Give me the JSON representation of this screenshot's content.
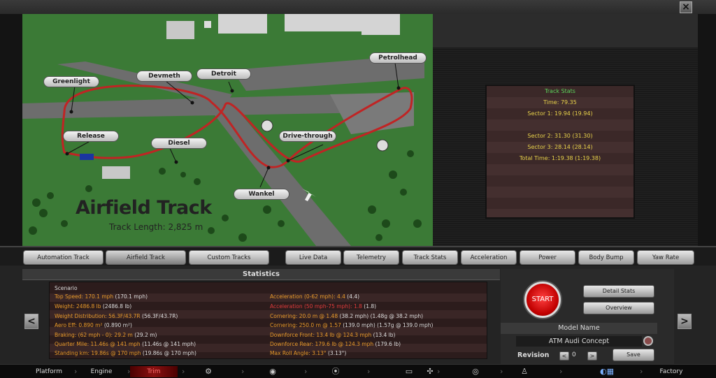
{
  "window": {
    "close_label": "×"
  },
  "map": {
    "title": "Airfield Track",
    "length": "Track Length: 2,825 m",
    "markers": [
      "Greenlight",
      "Devmeth",
      "Detroit",
      "Petrolhead",
      "Release",
      "Diesel",
      "Drive-through",
      "Wankel"
    ]
  },
  "track_stats": {
    "title": "Track Stats",
    "time": "Time: 79.35",
    "sector1": "Sector 1: 19.94 (19.94)",
    "sector2": "Sector 2: 31.30 (31.30)",
    "sector3": "Sector 3: 28.14 (28.14)",
    "total": "Total Time: 1:19.38 (1:19.38)"
  },
  "track_tabs": [
    "Automation Track",
    "Airfield Track",
    "Custom Tracks"
  ],
  "data_tabs": [
    "Live Data",
    "Telemetry",
    "Track Stats",
    "Acceleration",
    "Power",
    "Body Bump",
    "Yaw Rate"
  ],
  "statistics": {
    "title": "Statistics",
    "scenario": "Scenario",
    "left": [
      {
        "label": "Top Speed: 170.1 mph",
        "extra": " (170.1 mph)"
      },
      {
        "label": "Weight: 2486.8 lb",
        "extra": " (2486.8 lb)"
      },
      {
        "label": "Weight Distribution: 56.3F/43.7R",
        "extra": " (56.3F/43.7R)"
      },
      {
        "label": "Aero Eff: 0.890 m²",
        "extra": " (0.890 m²)"
      },
      {
        "label": "Braking: (62 mph - 0): 29.2 m",
        "extra": " (29.2 m)"
      },
      {
        "label": "Quarter Mile: 11.46s @ 141 mph",
        "extra": " (11.46s @ 141 mph)"
      },
      {
        "label": "Standing km: 19.86s @ 170 mph",
        "extra": " (19.86s @ 170 mph)"
      }
    ],
    "right": [
      {
        "label": "Acceleration (0-62 mph): 4.4",
        "extra": " (4.4)"
      },
      {
        "label": "Acceleration (50 mph-75 mph): 1.8",
        "extra": " (1.8)"
      },
      {
        "label": "Cornering: 20.0 m @ 1.48",
        "extra": " (38.2 mph) (1.48g @ 38.2 mph)"
      },
      {
        "label": "Cornering: 250.0 m @ 1.57",
        "extra": " (139.0 mph) (1.57g @ 139.0 mph)"
      },
      {
        "label": "Downforce Front: 13.4 lb @ 124.3 mph",
        "extra": " (13.4 lb)"
      },
      {
        "label": "Downforce Rear: 179.6 lb @ 124.3 mph",
        "extra": " (179.6 lb)"
      },
      {
        "label": "Max Roll Angle: 3.13°",
        "extra": " (3.13°)"
      }
    ]
  },
  "controls": {
    "start": "START",
    "detail_stats": "Detail Stats",
    "overview": "Overview",
    "model_name_label": "Model Name",
    "model_name": "ATM Audi Concept",
    "revision_label": "Revision",
    "revision_value": "0",
    "save": "Save",
    "prev": "<",
    "next": ">"
  },
  "nav": {
    "platform": "Platform",
    "engine": "Engine",
    "trim": "Trim",
    "factory": "Factory"
  },
  "colors": {
    "accent_red": "#c00000",
    "stat_orange": "#e89a2a",
    "stat_green": "#5cd65c",
    "stat_yellow": "#e8d24a"
  }
}
